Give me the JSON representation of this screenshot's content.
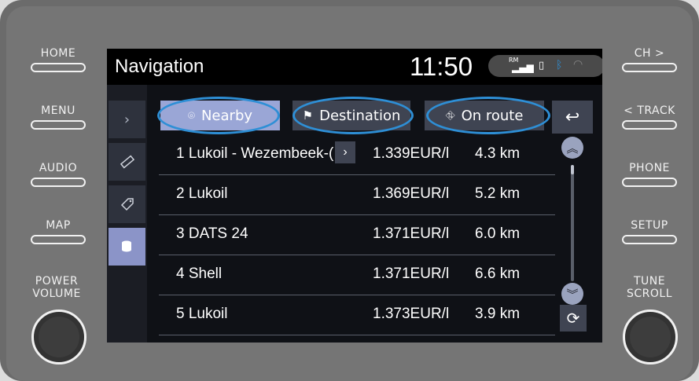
{
  "hardware": {
    "left": [
      "HOME",
      "MENU",
      "AUDIO",
      "MAP"
    ],
    "right": [
      "CH >",
      "< TRACK",
      "PHONE",
      "SETUP"
    ],
    "knob_left_line1": "POWER",
    "knob_left_line2": "VOLUME",
    "knob_right_line1": "TUNE",
    "knob_right_line2": "SCROLL"
  },
  "screen": {
    "title": "Navigation",
    "time": "11:50",
    "status": {
      "signal_label": "RM",
      "icons": [
        "signal-icon",
        "phone-icon",
        "bluetooth-icon",
        "wifi-icon"
      ]
    }
  },
  "sidebar": [
    {
      "icon": "chevron-right-icon"
    },
    {
      "icon": "ruler-icon"
    },
    {
      "icon": "tag-icon"
    },
    {
      "icon": "coins-icon",
      "active": true
    }
  ],
  "tabs": [
    {
      "label": "Nearby",
      "icon": "pin-icon",
      "active": true
    },
    {
      "label": "Destination",
      "icon": "checkered-flag-icon",
      "active": false
    },
    {
      "label": "On route",
      "icon": "route-icon",
      "active": false
    }
  ],
  "stations": [
    {
      "name": "1 Lukoil - Wezembeek-(",
      "price": "1.339EUR/l",
      "distance": "4.3 km",
      "has_more": true
    },
    {
      "name": "2 Lukoil",
      "price": "1.369EUR/l",
      "distance": "5.2 km"
    },
    {
      "name": "3 DATS 24",
      "price": "1.371EUR/l",
      "distance": "6.0 km"
    },
    {
      "name": "4 Shell",
      "price": "1.371EUR/l",
      "distance": "6.6 km"
    },
    {
      "name": "5 Lukoil",
      "price": "1.373EUR/l",
      "distance": "3.9 km"
    }
  ],
  "colors": {
    "accent": "#9aa6d6",
    "highlight_ring": "#2e8fd6",
    "screen_bg": "#0f1116"
  }
}
